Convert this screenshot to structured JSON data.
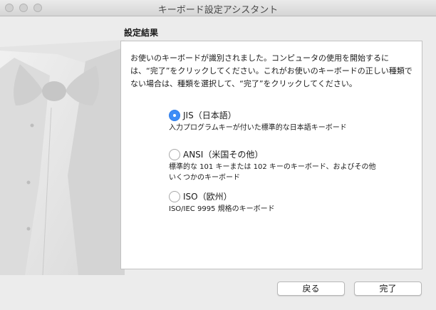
{
  "window": {
    "title": "キーボード設定アシスタント"
  },
  "section": {
    "title": "設定結果"
  },
  "instructions": "お使いのキーボードが識別されました。コンピュータの使用を開始するには、“完了”をクリックしてください。これがお使いのキーボードの正しい種類でない場合は、種類を選択して、“完了”をクリックしてください。",
  "options": [
    {
      "label": "JIS（日本語）",
      "description": "入力プログラムキーが付いた標準的な日本語キーボード",
      "selected": true
    },
    {
      "label": "ANSI（米国その他）",
      "description": "標準的な 101 キーまたは 102 キーのキーボード、およびその他いくつかのキーボード",
      "selected": false
    },
    {
      "label": "ISO（欧州）",
      "description": "ISO/IEC 9995 規格のキーボード",
      "selected": false
    }
  ],
  "buttons": {
    "back": "戻る",
    "done": "完了"
  },
  "colors": {
    "accent": "#3e8df7",
    "window_bg": "#ececec",
    "panel_bg": "#ffffff"
  }
}
